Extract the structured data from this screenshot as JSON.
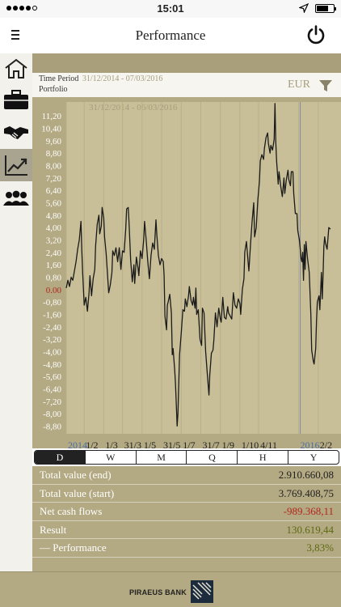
{
  "status": {
    "time": "15:01"
  },
  "header": {
    "title": "Performance"
  },
  "sidebar": [
    "home-icon",
    "briefcase-icon",
    "handshake-icon",
    "chart-icon",
    "people-icon"
  ],
  "filter": {
    "label": "Time Period",
    "range": "31/12/2014 - 07/03/2016",
    "sub": "Portfolio",
    "currency": "EUR"
  },
  "chart_data": {
    "type": "line",
    "watermark": "31/12/2014 - 06/03/2016",
    "y_ticks": [
      "11,20",
      "10,40",
      "9,60",
      "8,80",
      "8,00",
      "7,20",
      "6,40",
      "5,60",
      "4,80",
      "4,00",
      "3,20",
      "2,40",
      "1,60",
      "0,80",
      "0.00",
      "-0,80",
      "-1,60",
      "-2,40",
      "-3,20",
      "-4,00",
      "-4,80",
      "-5,60",
      "-6,40",
      "-7,20",
      "-8,00",
      "-8,80"
    ],
    "ylim": [
      -9.3,
      12.1
    ],
    "x_ticks": [
      {
        "label": "2014",
        "x": 0,
        "year": true
      },
      {
        "label": "1/2",
        "x": 22
      },
      {
        "label": "1/3",
        "x": 46
      },
      {
        "label": "31/3",
        "x": 69
      },
      {
        "label": "1/5",
        "x": 93
      },
      {
        "label": "31/5",
        "x": 117
      },
      {
        "label": "1/7",
        "x": 141
      },
      {
        "label": "31/7",
        "x": 165
      },
      {
        "label": "1/9",
        "x": 189
      },
      {
        "label": "1/10",
        "x": 213
      },
      {
        "label": "4/11",
        "x": 236
      },
      {
        "label": "2016",
        "x": 285,
        "year": true
      },
      {
        "label": "2/2",
        "x": 309
      }
    ],
    "xlim": [
      0,
      337
    ],
    "year_line_x": 287,
    "points": [
      [
        0,
        0.1
      ],
      [
        2,
        0.6
      ],
      [
        4,
        0.2
      ],
      [
        6,
        0.8
      ],
      [
        8,
        0.6
      ],
      [
        10,
        1.2
      ],
      [
        12,
        1.8
      ],
      [
        14,
        2.6
      ],
      [
        16,
        3.2
      ],
      [
        18,
        4.4
      ],
      [
        19,
        2.6
      ],
      [
        20,
        1.2
      ],
      [
        22,
        -1.0
      ],
      [
        24,
        -0.5
      ],
      [
        26,
        -1.4
      ],
      [
        28,
        -0.2
      ],
      [
        29,
        0.9
      ],
      [
        31,
        -0.4
      ],
      [
        33,
        0.7
      ],
      [
        35,
        1.3
      ],
      [
        36,
        2.8
      ],
      [
        38,
        4.2
      ],
      [
        40,
        4.8
      ],
      [
        41,
        3.6
      ],
      [
        43,
        4.1
      ],
      [
        44,
        5.3
      ],
      [
        46,
        4.6
      ],
      [
        47,
        3.4
      ],
      [
        49,
        2.3
      ],
      [
        50,
        1.5
      ],
      [
        52,
        -0.2
      ],
      [
        54,
        0.3
      ],
      [
        56,
        1.1
      ],
      [
        57,
        2.5
      ],
      [
        59,
        2.2
      ],
      [
        61,
        2.7
      ],
      [
        63,
        1.8
      ],
      [
        65,
        2.7
      ],
      [
        67,
        1.3
      ],
      [
        69,
        2.5
      ],
      [
        71,
        2.4
      ],
      [
        73,
        3.9
      ],
      [
        74,
        5.2
      ],
      [
        76,
        5.3
      ],
      [
        77,
        4.3
      ],
      [
        79,
        1.9
      ],
      [
        81,
        0.5
      ],
      [
        83,
        1.6
      ],
      [
        84,
        0.4
      ],
      [
        86,
        2.1
      ],
      [
        88,
        1.4
      ],
      [
        89,
        0.9
      ],
      [
        91,
        2.5
      ],
      [
        93,
        2.0
      ],
      [
        95,
        3.2
      ],
      [
        96,
        4.4
      ],
      [
        98,
        3.2
      ],
      [
        100,
        1.8
      ],
      [
        102,
        0.7
      ],
      [
        104,
        2.2
      ],
      [
        106,
        3.0
      ],
      [
        108,
        2.6
      ],
      [
        110,
        4.5
      ],
      [
        111,
        3.6
      ],
      [
        113,
        2.2
      ],
      [
        115,
        1.6
      ],
      [
        117,
        2.0
      ],
      [
        119,
        1.8
      ],
      [
        120,
        0.9
      ],
      [
        121,
        -1.7
      ],
      [
        123,
        -2.6
      ],
      [
        124,
        -1.0
      ],
      [
        125,
        -0.8
      ],
      [
        127,
        -0.3
      ],
      [
        129,
        -1.5
      ],
      [
        130,
        -4.2
      ],
      [
        131,
        -3.8
      ],
      [
        133,
        -5.2
      ],
      [
        134,
        -6.1
      ],
      [
        136,
        -8.8
      ],
      [
        137,
        -8.0
      ],
      [
        139,
        -4.2
      ],
      [
        141,
        -2.8
      ],
      [
        143,
        -1.3
      ],
      [
        145,
        -1.4
      ],
      [
        146,
        -0.6
      ],
      [
        148,
        -1.1
      ],
      [
        150,
        -0.4
      ],
      [
        151,
        0.2
      ],
      [
        153,
        -0.7
      ],
      [
        155,
        -1.0
      ],
      [
        156,
        -0.5
      ],
      [
        158,
        -1.2
      ],
      [
        159,
        0.1
      ],
      [
        160,
        -1.6
      ],
      [
        162,
        -1.3
      ],
      [
        164,
        -3.2
      ],
      [
        166,
        -3.6
      ],
      [
        167,
        -1.2
      ],
      [
        169,
        -1.5
      ],
      [
        171,
        -4.0
      ],
      [
        173,
        -5.4
      ],
      [
        175,
        -6.8
      ],
      [
        176,
        -5.5
      ],
      [
        178,
        -4.1
      ],
      [
        180,
        -3.9
      ],
      [
        181,
        -3.3
      ],
      [
        183,
        -1.5
      ],
      [
        185,
        -2.4
      ],
      [
        187,
        -1.2
      ],
      [
        189,
        -1.9
      ],
      [
        190,
        -2.1
      ],
      [
        192,
        -0.5
      ],
      [
        194,
        -1.8
      ],
      [
        196,
        -1.9
      ],
      [
        198,
        -1.1
      ],
      [
        199,
        -1.5
      ],
      [
        201,
        -1.7
      ],
      [
        203,
        -1.9
      ],
      [
        205,
        -0.2
      ],
      [
        207,
        -1.0
      ],
      [
        209,
        -1.2
      ],
      [
        211,
        -0.6
      ],
      [
        213,
        -0.9
      ],
      [
        214,
        -1.6
      ],
      [
        216,
        0.0
      ],
      [
        218,
        0.7
      ],
      [
        219,
        2.4
      ],
      [
        221,
        3.1
      ],
      [
        223,
        1.8
      ],
      [
        224,
        1.2
      ],
      [
        226,
        2.9
      ],
      [
        228,
        4.4
      ],
      [
        230,
        5.6
      ],
      [
        231,
        3.4
      ],
      [
        233,
        4.0
      ],
      [
        235,
        5.8
      ],
      [
        237,
        7.0
      ],
      [
        238,
        8.3
      ],
      [
        240,
        8.7
      ],
      [
        242,
        8.4
      ],
      [
        243,
        9.1
      ],
      [
        245,
        9.8
      ],
      [
        247,
        10.1
      ],
      [
        248,
        9.4
      ],
      [
        250,
        8.8
      ],
      [
        251,
        9.3
      ],
      [
        253,
        9.0
      ],
      [
        255,
        9.7
      ],
      [
        256,
        12.0
      ],
      [
        257,
        9.5
      ],
      [
        258,
        8.3
      ],
      [
        260,
        6.8
      ],
      [
        261,
        7.6
      ],
      [
        263,
        6.7
      ],
      [
        265,
        6.0
      ],
      [
        267,
        7.2
      ],
      [
        268,
        6.2
      ],
      [
        270,
        7.1
      ],
      [
        272,
        7.7
      ],
      [
        273,
        7.1
      ],
      [
        275,
        6.7
      ],
      [
        276,
        7.6
      ],
      [
        278,
        7.6
      ],
      [
        279,
        6.2
      ],
      [
        281,
        4.9
      ],
      [
        283,
        4.9
      ],
      [
        284,
        3.8
      ],
      [
        286,
        3.2
      ],
      [
        287,
        2.6
      ],
      [
        288,
        2.0
      ],
      [
        289,
        1.8
      ],
      [
        290,
        2.4
      ],
      [
        291,
        0.6
      ],
      [
        292,
        2.9
      ],
      [
        293,
        1.3
      ],
      [
        294,
        3.1
      ],
      [
        296,
        2.0
      ],
      [
        298,
        1.1
      ],
      [
        300,
        -1.6
      ],
      [
        301,
        -3.9
      ],
      [
        303,
        -4.6
      ],
      [
        304,
        -4.8
      ],
      [
        306,
        -3.8
      ],
      [
        307,
        -2.0
      ],
      [
        308,
        -0.8
      ],
      [
        310,
        -0.4
      ],
      [
        311,
        -1.3
      ],
      [
        313,
        1.1
      ],
      [
        314,
        -0.6
      ],
      [
        315,
        0.9
      ],
      [
        316,
        2.8
      ],
      [
        317,
        3.4
      ],
      [
        318,
        3.0
      ],
      [
        320,
        2.6
      ],
      [
        322,
        4.0
      ],
      [
        324,
        3.9
      ]
    ]
  },
  "periods": [
    "D",
    "W",
    "M",
    "Q",
    "H",
    "Y"
  ],
  "summary": [
    {
      "label": "Total value (end)",
      "value": "2.910.660,08",
      "tone": "normal"
    },
    {
      "label": "Total value (start)",
      "value": "3.769.408,75",
      "tone": "normal"
    },
    {
      "label": "Net cash flows",
      "value": "-989.368,11",
      "tone": "neg"
    },
    {
      "label": "Result",
      "value": "130.619,44",
      "tone": "pos"
    },
    {
      "label": "— Performance",
      "value": "3,83%",
      "tone": "pos"
    }
  ],
  "footer": {
    "bank": "PIRAEUS BANK"
  },
  "colors": {
    "gold": "#b3a982",
    "zero": "#b3261e",
    "year": "#4a6fa5"
  }
}
